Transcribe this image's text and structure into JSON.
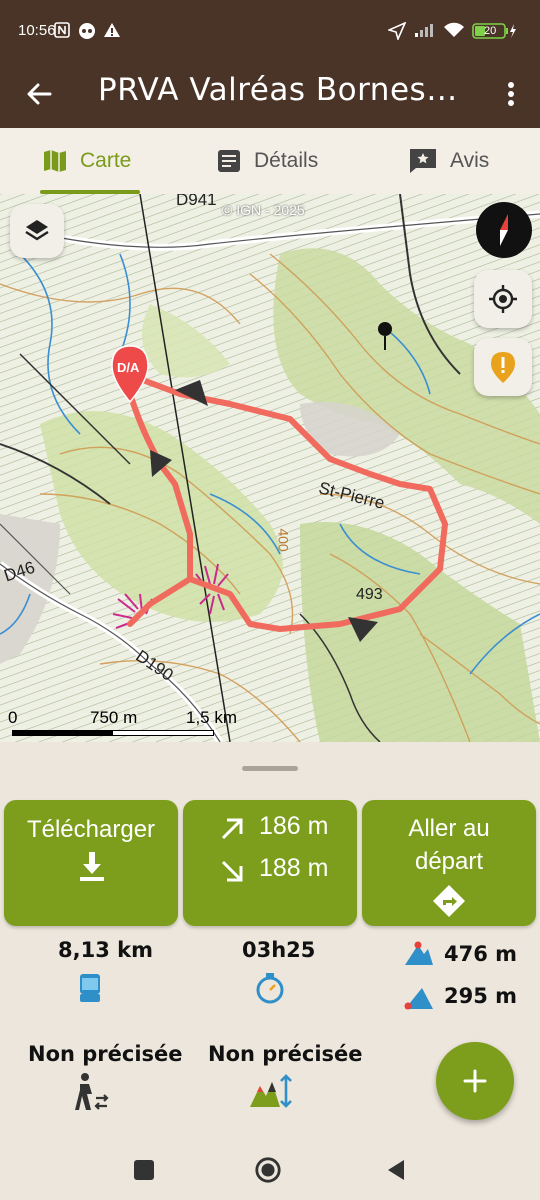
{
  "status_bar": {
    "time": "10:56",
    "battery": "20"
  },
  "app_bar": {
    "title": "PRVA Valréas Bornes p…"
  },
  "tabs": [
    {
      "label": "Carte",
      "icon": "map-icon",
      "active": true
    },
    {
      "label": "Détails",
      "icon": "details-icon",
      "active": false
    },
    {
      "label": "Avis",
      "icon": "review-icon",
      "active": false
    }
  ],
  "map": {
    "copyright": "© IGN - 2025",
    "marker_label": "D/A",
    "place_label": "St-Pierre",
    "road_labels": [
      "D941",
      "D46",
      "D190",
      "400",
      "493"
    ],
    "scale_labels": [
      "0",
      "750 m",
      "1,5 km"
    ]
  },
  "actions": {
    "download_label": "Télécharger",
    "ascent": "186 m",
    "descent": "188 m",
    "go_start_label": "Aller au départ"
  },
  "stats": {
    "distance": "8,13 km",
    "duration": "03h25",
    "max_altitude": "476 m",
    "min_altitude": "295 m",
    "activity": "Non précisée",
    "difficulty": "Non précisée"
  },
  "colors": {
    "header": "#4a3327",
    "accent": "#7c9e1c",
    "route": "#f06a5e"
  }
}
